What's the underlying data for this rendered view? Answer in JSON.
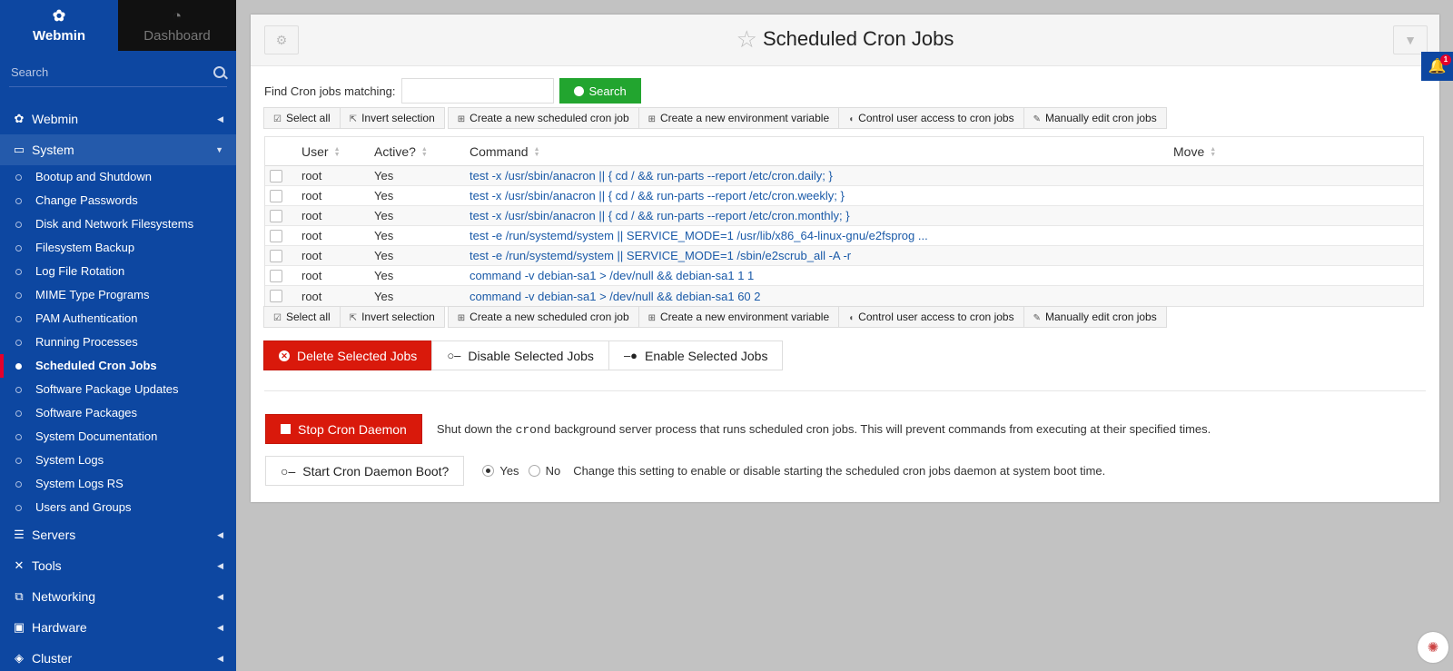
{
  "sidebar": {
    "tabs": [
      {
        "label": "Webmin",
        "icon": "webmin-logo-icon"
      },
      {
        "label": "Dashboard",
        "icon": "dashboard-gauge-icon"
      }
    ],
    "search_placeholder": "Search",
    "categories": {
      "webmin": {
        "label": "Webmin"
      },
      "system": {
        "label": "System",
        "items": [
          "Bootup and Shutdown",
          "Change Passwords",
          "Disk and Network Filesystems",
          "Filesystem Backup",
          "Log File Rotation",
          "MIME Type Programs",
          "PAM Authentication",
          "Running Processes",
          "Scheduled Cron Jobs",
          "Software Package Updates",
          "Software Packages",
          "System Documentation",
          "System Logs",
          "System Logs RS",
          "Users and Groups"
        ]
      },
      "servers": {
        "label": "Servers"
      },
      "tools": {
        "label": "Tools"
      },
      "networking": {
        "label": "Networking"
      },
      "hardware": {
        "label": "Hardware"
      },
      "cluster": {
        "label": "Cluster"
      }
    }
  },
  "header": {
    "title": "Scheduled Cron Jobs"
  },
  "find": {
    "label": "Find Cron jobs matching:",
    "value": "",
    "button": "Search"
  },
  "toolbar": {
    "select_all": "Select all",
    "invert": "Invert selection",
    "new_job": "Create a new scheduled cron job",
    "new_env": "Create a new environment variable",
    "access": "Control user access to cron jobs",
    "manual": "Manually edit cron jobs"
  },
  "table": {
    "headers": {
      "user": "User",
      "active": "Active?",
      "command": "Command",
      "move": "Move"
    },
    "rows": [
      {
        "user": "root",
        "active": "Yes",
        "command": "test -x /usr/sbin/anacron || { cd / && run-parts --report /etc/cron.daily; }"
      },
      {
        "user": "root",
        "active": "Yes",
        "command": "test -x /usr/sbin/anacron || { cd / && run-parts --report /etc/cron.weekly; }"
      },
      {
        "user": "root",
        "active": "Yes",
        "command": "test -x /usr/sbin/anacron || { cd / && run-parts --report /etc/cron.monthly; }"
      },
      {
        "user": "root",
        "active": "Yes",
        "command": "test -e /run/systemd/system || SERVICE_MODE=1 /usr/lib/x86_64-linux-gnu/e2fsprog ..."
      },
      {
        "user": "root",
        "active": "Yes",
        "command": "test -e /run/systemd/system || SERVICE_MODE=1 /sbin/e2scrub_all -A -r"
      },
      {
        "user": "root",
        "active": "Yes",
        "command": "command -v debian-sa1 > /dev/null && debian-sa1 1 1"
      },
      {
        "user": "root",
        "active": "Yes",
        "command": "command -v debian-sa1 > /dev/null && debian-sa1 60 2"
      }
    ]
  },
  "actions": {
    "delete": "Delete Selected Jobs",
    "disable": "Disable Selected Jobs",
    "enable": "Enable Selected Jobs"
  },
  "daemon": {
    "stop_label": "Stop Cron Daemon",
    "stop_desc_pre": "Shut down the ",
    "stop_desc_code": "crond",
    "stop_desc_post": " background server process that runs scheduled cron jobs. This will prevent commands from executing at their specified times.",
    "boot_label": "Start Cron Daemon Boot?",
    "yes": "Yes",
    "no": "No",
    "boot_desc": "Change this setting to enable or disable starting the scheduled cron jobs daemon at system boot time."
  },
  "notifications": {
    "count": "1"
  },
  "colors": {
    "sidebar": "#0d47a1",
    "danger": "#d9190b",
    "success": "#22a52f",
    "link": "#1a5aa8"
  }
}
